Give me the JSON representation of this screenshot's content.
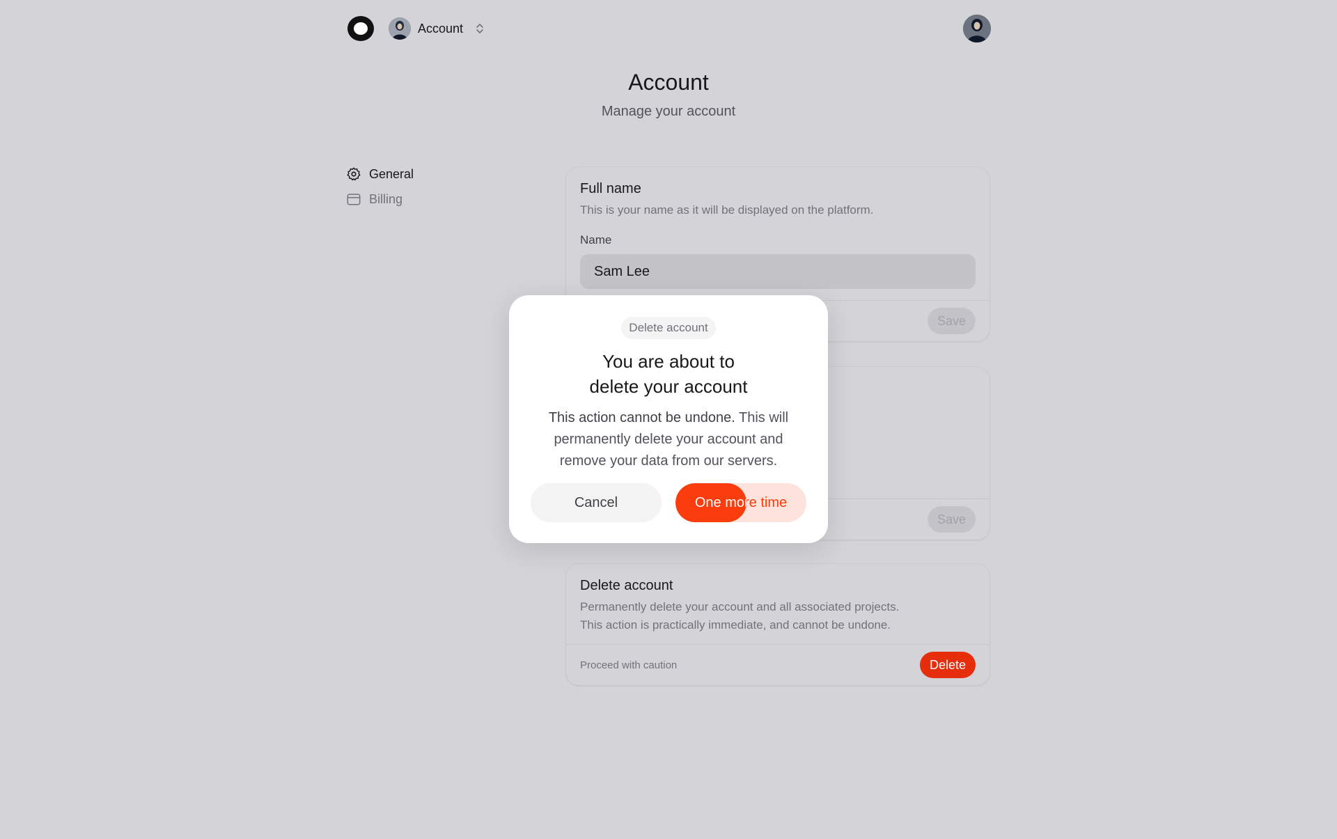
{
  "topbar": {
    "account_label": "Account"
  },
  "header": {
    "title": "Account",
    "subtitle": "Manage your account"
  },
  "sidebar": {
    "items": [
      {
        "label": "General",
        "icon": "gear-icon",
        "active": true
      },
      {
        "label": "Billing",
        "icon": "wallet-icon",
        "active": false
      }
    ]
  },
  "cards": {
    "full_name": {
      "title": "Full name",
      "description": "This is your name as it will be displayed on the platform.",
      "field_label": "Name",
      "field_value": "Sam Lee",
      "save_label": "Save"
    },
    "second": {
      "save_label": "Save"
    },
    "delete_account": {
      "title": "Delete account",
      "description_line1": "Permanently delete your account and all associated projects.",
      "description_line2": "This action is practically immediate, and cannot be undone.",
      "footer_note": "Proceed with caution",
      "delete_label": "Delete"
    }
  },
  "modal": {
    "chip": "Delete account",
    "title_line1": "You are about to",
    "title_line2": "delete your account",
    "text_strong": "This action cannot be undone.",
    "text_rest_1": "This will",
    "text_rest_2": "permanently delete your account and",
    "text_rest_3": "remove your data from our servers.",
    "cancel_label": "Cancel",
    "confirm_label": "One more time",
    "confirm_progress": 0.54
  },
  "colors": {
    "accent": "#fb3c0c",
    "danger": "#e62e0c",
    "background": "#d4d4d8"
  }
}
